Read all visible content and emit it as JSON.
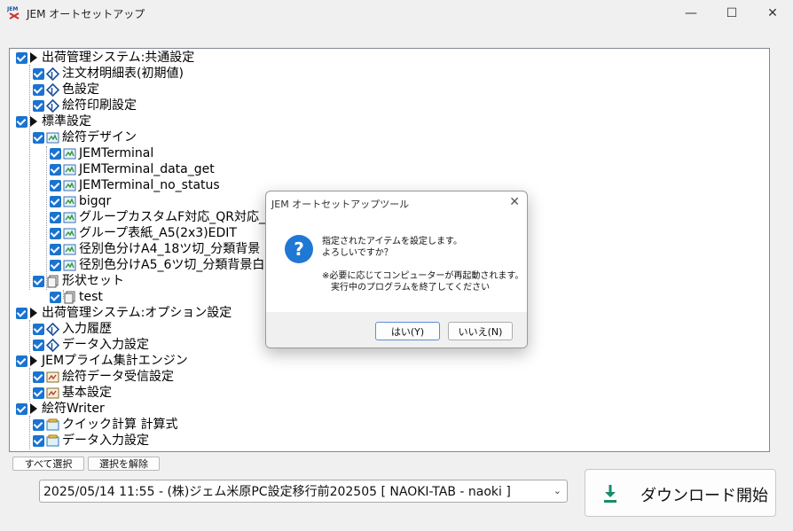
{
  "window": {
    "title": "JEM オートセットアップ",
    "min": "—",
    "max": "☐",
    "close": "✕"
  },
  "tree": {
    "items": [
      {
        "label": "出荷管理システム:共通設定"
      },
      {
        "label": "注文材明細表(初期値)"
      },
      {
        "label": "色設定"
      },
      {
        "label": "絵符印刷設定"
      },
      {
        "label": "標準設定"
      },
      {
        "label": "絵符デザイン"
      },
      {
        "label": "JEMTerminal"
      },
      {
        "label": "JEMTerminal_data_get"
      },
      {
        "label": "JEMTerminal_no_status"
      },
      {
        "label": "bigqr"
      },
      {
        "label": "グループカスタムF対応_QR対応_表"
      },
      {
        "label": "グループ表紙_A5(2x3)EDIT"
      },
      {
        "label": "径別色分けA4_18ツ切_分類背景"
      },
      {
        "label": "径別色分けA5_6ツ切_分類背景白"
      },
      {
        "label": "形状セット"
      },
      {
        "label": "test"
      },
      {
        "label": "出荷管理システム:オプション設定"
      },
      {
        "label": "入力履歴"
      },
      {
        "label": "データ入力設定"
      },
      {
        "label": "JEMプライム集計エンジン"
      },
      {
        "label": "絵符データ受信設定"
      },
      {
        "label": "基本設定"
      },
      {
        "label": "絵符Writer"
      },
      {
        "label": "クイック計算 計算式"
      },
      {
        "label": "データ入力設定"
      }
    ]
  },
  "buttons": {
    "select_all": "すべて選択",
    "deselect": "選択を解除",
    "download": "ダウンロード開始"
  },
  "combo": {
    "value": "2025/05/14 11:55 - (株)ジェム米原PC設定移行前202505 [ NAOKI-TAB - naoki ]"
  },
  "dialog": {
    "title": "JEM オートセットアップツール",
    "line1": "指定されたアイテムを設定します。",
    "line2": "よろしいですか？",
    "line3": "※必要に応じてコンピューターが再起動されます。",
    "line4": "実行中のプログラムを終了してください",
    "yes": "はい(Y)",
    "no": "いいえ(N)",
    "icon": "?"
  },
  "colors": {
    "accent": "#1a73d1",
    "download_icon": "#1a8a6a"
  }
}
